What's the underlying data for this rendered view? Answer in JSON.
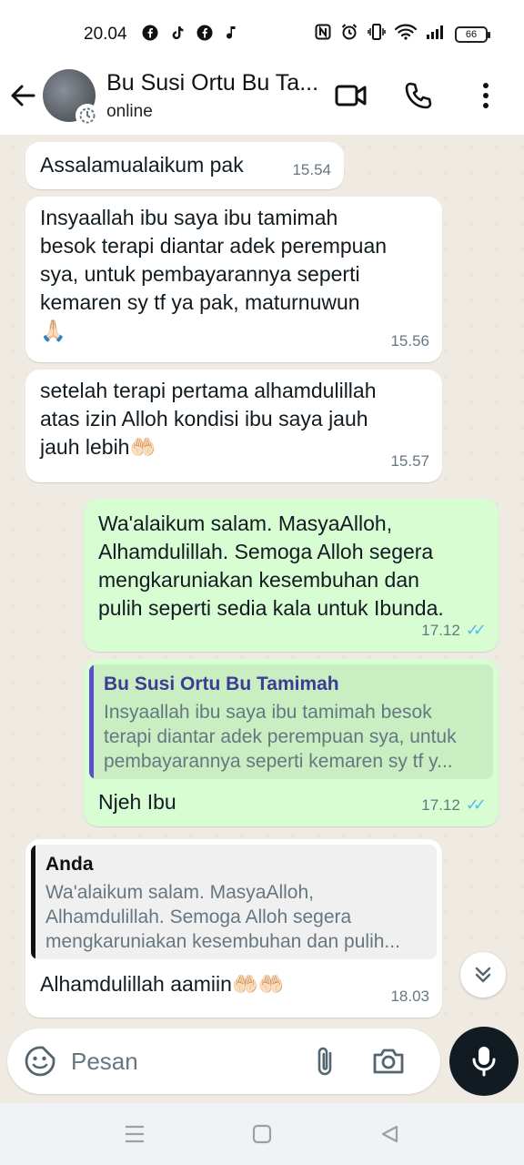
{
  "status_bar": {
    "time": "20.04",
    "battery": "66",
    "left_icons": [
      "facebook-icon",
      "tiktok-icon",
      "facebook-icon",
      "music-note-icon"
    ],
    "right_icons": [
      "nfc-icon",
      "alarm-icon",
      "vibrate-icon",
      "wifi-icon",
      "signal-icon",
      "battery-icon"
    ]
  },
  "header": {
    "contact_name": "Bu Susi Ortu Bu Ta...",
    "status": "online"
  },
  "messages": [
    {
      "direction": "in",
      "text": "Assalamualaikum pak",
      "time": "15.54"
    },
    {
      "direction": "in",
      "text": "Insyaallah ibu saya ibu tamimah\nbesok terapi diantar adek perempuan\nsya, untuk pembayarannya seperti\nkemaren sy tf ya pak, maturnuwun\n🙏🏻",
      "time": "15.56"
    },
    {
      "direction": "in",
      "text": "setelah terapi pertama alhamdulillah\natas izin Alloh kondisi ibu saya jauh\njauh lebih🤲🏻",
      "time": "15.57"
    },
    {
      "direction": "out",
      "text": "Wa'alaikum salam. MasyaAlloh,\nAlhamdulillah. Semoga Alloh segera\nmengkaruniakan kesembuhan dan\npulih seperti sedia kala untuk Ibunda.",
      "time": "17.12",
      "read": true
    },
    {
      "direction": "out",
      "quote_author": "Bu Susi Ortu Bu Tamimah",
      "quote_text": "Insyaallah ibu saya ibu tamimah  besok\nterapi diantar adek perempuan sya, untuk\npembayarannya seperti kemaren sy tf y...",
      "text": "Njeh Ibu",
      "time": "17.12",
      "read": true
    },
    {
      "direction": "in",
      "quote_author": "Anda",
      "quote_text": "Wa'alaikum salam. MasyaAlloh,\nAlhamdulillah. Semoga Alloh segera\nmengkaruniakan kesembuhan dan pulih...",
      "text": "Alhamdulillah aamiin🤲🏻🤲🏻",
      "time": "18.03"
    }
  ],
  "input": {
    "placeholder": "Pesan"
  },
  "colors": {
    "incoming_bubble": "#ffffff",
    "outgoing_bubble": "#d9fdd3",
    "read_ticks": "#53bdeb",
    "chat_background": "#efeae2",
    "quote_bar_outgoing": "#5b4fd0",
    "mic_button": "#111b21"
  }
}
